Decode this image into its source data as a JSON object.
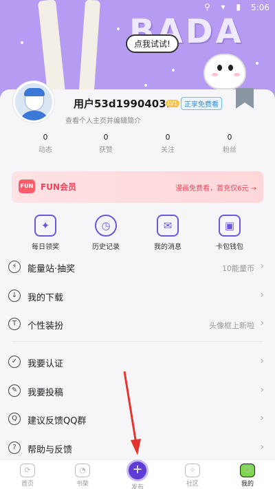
{
  "status_bar": {
    "time": "5:06",
    "icons": "⚲ ▾ ▮"
  },
  "banner": {
    "logo_text": "BADA",
    "bubble": "点我试试!"
  },
  "profile": {
    "username": "用户53d1990403...",
    "level": "LV1",
    "free_tag": "正享免费看",
    "subtitle": "查看个人主页并编辑简介",
    "stats": [
      {
        "num": "0",
        "label": "动态"
      },
      {
        "num": "0",
        "label": "获赞"
      },
      {
        "num": "0",
        "label": "关注"
      },
      {
        "num": "0",
        "label": "粉丝"
      }
    ]
  },
  "fun_vip": {
    "logo": "FUN",
    "title": "FUN会员",
    "promo": "漫画免费看，首充仅6元 →"
  },
  "tiles": [
    {
      "label": "每日领奖",
      "icon": "sparkle-icon",
      "glyph": "✦"
    },
    {
      "label": "历史记录",
      "icon": "clock-icon",
      "glyph": "◷"
    },
    {
      "label": "我的消息",
      "icon": "envelope-icon",
      "glyph": "✉"
    },
    {
      "label": "卡包钱包",
      "icon": "wallet-icon",
      "glyph": "▣"
    }
  ],
  "menu": [
    {
      "label": "能量站·抽奖",
      "hint": "10能量币",
      "icon": "energy-icon",
      "glyph": "⚡"
    },
    {
      "label": "我的下载",
      "hint": "",
      "icon": "download-icon",
      "glyph": "↓"
    },
    {
      "label": "个性装扮",
      "hint": "头像框上新啦",
      "icon": "tshirt-icon",
      "glyph": "T"
    },
    {
      "label": "我要认证",
      "hint": "",
      "icon": "verify-icon",
      "glyph": "✓"
    },
    {
      "label": "我要投稿",
      "hint": "",
      "icon": "submit-icon",
      "glyph": "✎"
    },
    {
      "label": "建议反馈QQ群",
      "hint": "",
      "icon": "qq-icon",
      "glyph": "Q"
    },
    {
      "label": "帮助与反馈",
      "hint": "",
      "icon": "help-icon",
      "glyph": "?"
    }
  ],
  "nav": [
    {
      "label": "首页",
      "icon": "home-icon",
      "glyph": "⟳"
    },
    {
      "label": "书架",
      "icon": "bookshelf-icon",
      "glyph": "◔"
    },
    {
      "label": "发布",
      "icon": "publish-icon",
      "glyph": "+"
    },
    {
      "label": "社区",
      "icon": "community-icon",
      "glyph": "✧"
    },
    {
      "label": "我的",
      "icon": "me-icon",
      "glyph": "☺"
    }
  ],
  "colors": {
    "accent": "#6c55e0",
    "banner": "#b59bf2",
    "fun_red": "#e8455a",
    "annotation": "#e3342f"
  }
}
